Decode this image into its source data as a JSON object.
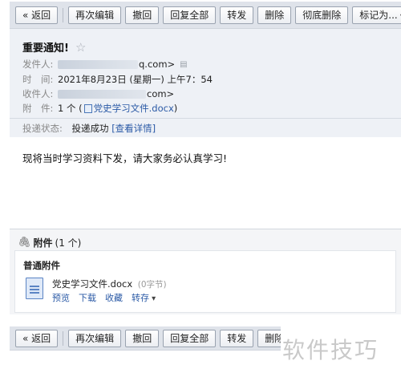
{
  "toolbar": {
    "buttons": [
      "« 返回",
      "再次编辑",
      "撤回",
      "回复全部",
      "转发",
      "删除",
      "彻底删除",
      "标记为..."
    ]
  },
  "email": {
    "subject": "重要通知!",
    "from_label": "发件人:",
    "from_value": "q.com>",
    "time_label": "时　间:",
    "time_value": "2021年8月23日 (星期一) 上午7：54",
    "to_label": "收件人:",
    "to_value": "com>",
    "attach_label": "附　件:",
    "attach_prefix": "1 个 (",
    "attach_name": "党史学习文件.docx",
    "attach_suffix": ")",
    "status_label": "投递状态:",
    "status_value": "投递成功",
    "status_link": "[查看详情]",
    "body": "现将当时学习资料下发，请大家务必认真学习!"
  },
  "attachments": {
    "title": "附件",
    "count": "(1 个)",
    "group": "普通附件",
    "file_name": "党史学习文件.docx",
    "file_size": "(0字节)",
    "actions": [
      "预览",
      "下载",
      "收藏",
      "转存"
    ]
  },
  "bottom_toolbar": {
    "buttons": [
      "« 返回",
      "再次编辑",
      "撤回",
      "回复全部",
      "转发",
      "删除"
    ]
  },
  "watermark": "软件技巧"
}
